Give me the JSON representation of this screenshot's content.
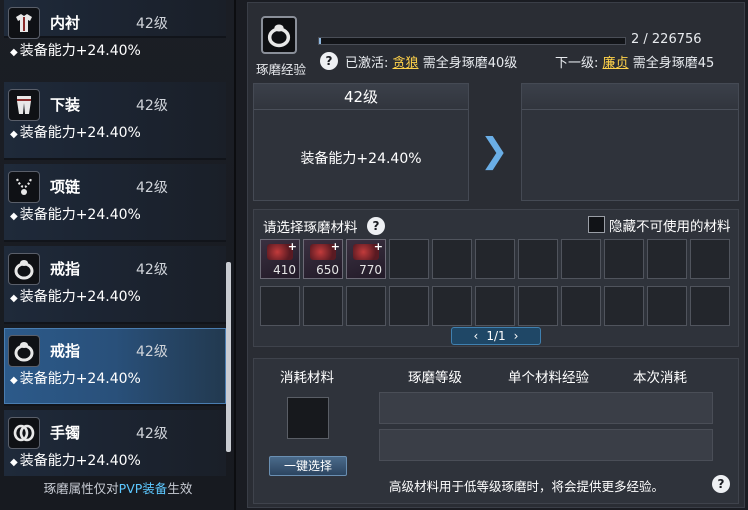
{
  "left_panel": {
    "items": [
      {
        "name": "内衬",
        "level": "42级",
        "attr": "装备能力+24.40%",
        "icon": "shirt-icon",
        "selected": false
      },
      {
        "name": "下装",
        "level": "42级",
        "attr": "装备能力+24.40%",
        "icon": "pants-icon",
        "selected": false
      },
      {
        "name": "项链",
        "level": "42级",
        "attr": "装备能力+24.40%",
        "icon": "necklace-icon",
        "selected": false
      },
      {
        "name": "戒指",
        "level": "42级",
        "attr": "装备能力+24.40%",
        "icon": "ring-icon",
        "selected": false
      },
      {
        "name": "戒指",
        "level": "42级",
        "attr": "装备能力+24.40%",
        "icon": "ring-icon",
        "selected": true
      },
      {
        "name": "手镯",
        "level": "42级",
        "attr": "装备能力+24.40%",
        "icon": "bracelet-icon",
        "selected": false
      }
    ],
    "attr_bullet": "◆",
    "footer_prefix": "琢磨属性仅对",
    "footer_pvp": "PVP装备",
    "footer_suffix": "生效"
  },
  "header": {
    "icon_label": "琢磨经验",
    "progress_text": "2 / 226756",
    "progress_fraction": 1e-05,
    "help": "?",
    "activated_label": "已激活:",
    "activated_link": "贪狼",
    "activated_desc": "需全身琢磨40级",
    "next_label": "下一级:",
    "next_link": "廉贞",
    "next_desc": "需全身琢磨45"
  },
  "compare": {
    "current_level": "42级",
    "current_attr": "装备能力+24.40%",
    "arrow": "❯",
    "next_level": "",
    "next_attr": ""
  },
  "materials": {
    "title": "请选择琢磨材料",
    "help": "?",
    "hide_label": "隐藏不可使用的材料",
    "filled_slots": [
      {
        "count": "410"
      },
      {
        "count": "650"
      },
      {
        "count": "770"
      }
    ],
    "pager": "1/1",
    "pager_prev": "‹",
    "pager_next": "›"
  },
  "consume": {
    "col_material": "消耗材料",
    "col_level": "琢磨等级",
    "col_exp": "单个材料经验",
    "col_cost": "本次消耗",
    "one_key_button": "一键选择",
    "note": "高级材料用于低等级琢磨时，将会提供更多经验。",
    "help": "?"
  },
  "colors": {
    "accent_blue": "#5dc8ff",
    "link_yellow": "#ffd24a",
    "selected_row": "#2c5a8a"
  }
}
